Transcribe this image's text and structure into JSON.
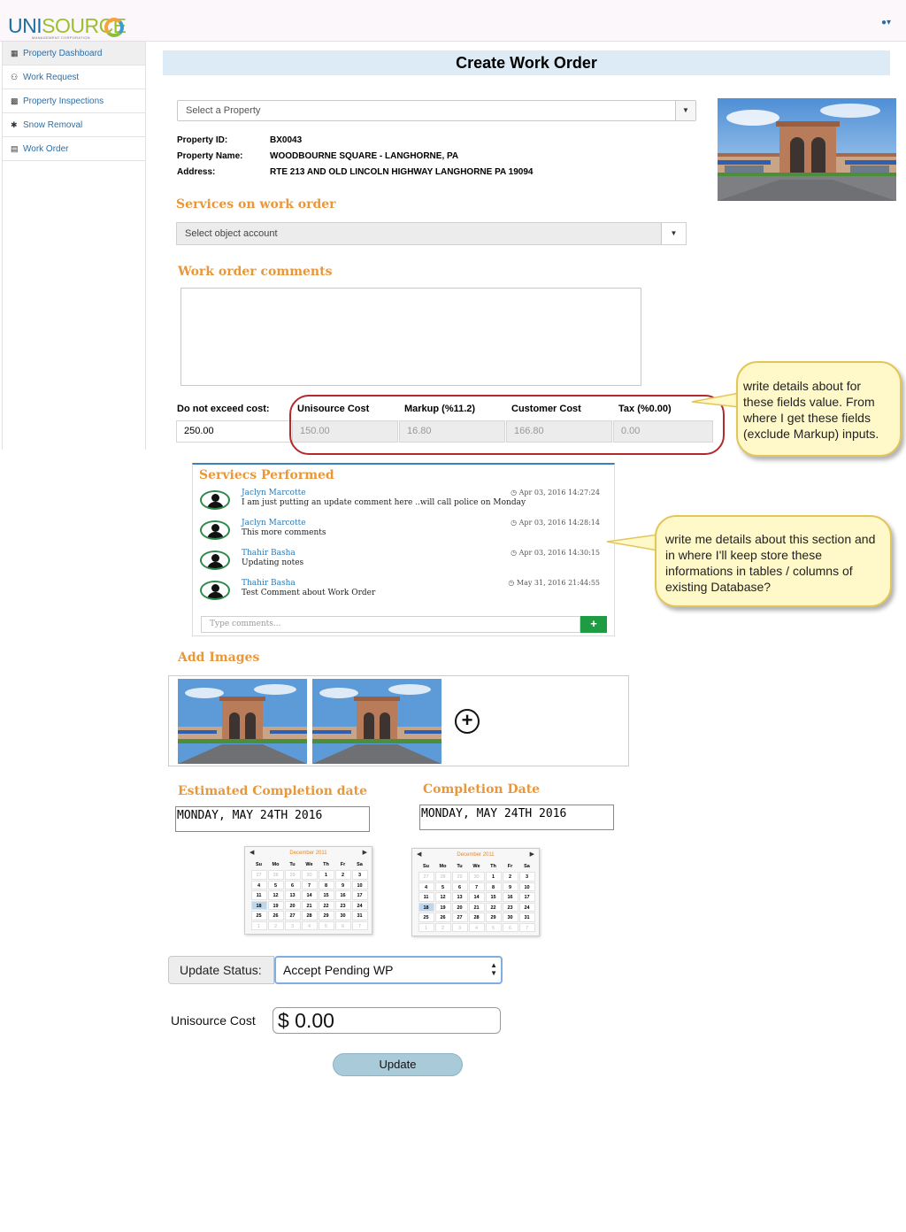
{
  "app": {
    "logo_main": "UNI",
    "logo_accent": "SOURCE",
    "logo_sub": "MANAGEMENT CORPORATION",
    "user_menu": "▾"
  },
  "sidebar": {
    "items": [
      {
        "label": "Property Dashboard",
        "icon": "building-icon"
      },
      {
        "label": "Work Request",
        "icon": "users-icon"
      },
      {
        "label": "Property Inspections",
        "icon": "folder-icon"
      },
      {
        "label": "Snow Removal",
        "icon": "shovel-icon"
      },
      {
        "label": "Work Order",
        "icon": "document-icon"
      }
    ]
  },
  "page": {
    "title": "Create Work Order"
  },
  "property": {
    "select_placeholder": "Select a Property",
    "id_label": "Property ID:",
    "id_value": "BX0043",
    "name_label": "Property Name:",
    "name_value": "WOODBOURNE SQUARE - LANGHORNE, PA",
    "address_label": "Address:",
    "address_value": "RTE 213 AND OLD LINCOLN HIGHWAY LANGHORNE PA 19094"
  },
  "services": {
    "heading": "Services on work order",
    "select_placeholder": "Select object account"
  },
  "comments": {
    "heading": "Work order comments"
  },
  "costs": {
    "dne_label": "Do not exceed cost:",
    "dne_value": "250.00",
    "unisource_label": "Unisource Cost",
    "unisource_value": "150.00",
    "markup_label": "Markup (%11.2)",
    "markup_value": "16.80",
    "customer_label": "Customer Cost",
    "customer_value": "166.80",
    "tax_label": "Tax (%0.00)",
    "tax_value": "0.00"
  },
  "callouts": {
    "c1": "write details about for these fields value. From where I get these fields (exclude Markup) inputs.",
    "c2": "write me details about this section and in where I'll keep store these informations in tables / columns of existing Database?"
  },
  "performed": {
    "heading": "Serviecs Performed",
    "entries": [
      {
        "name": "Jaclyn Marcotte",
        "text": "I am just putting an update comment here ..will call police on Monday",
        "time": "Apr 03, 2016 14:27:24"
      },
      {
        "name": "Jaclyn Marcotte",
        "text": "This more comments",
        "time": "Apr 03, 2016 14:28:14"
      },
      {
        "name": "Thahir Basha",
        "text": "Updating notes",
        "time": "Apr 03, 2016 14:30:15"
      },
      {
        "name": "Thahir Basha",
        "text": "Test Comment about Work Order",
        "time": "May 31, 2016 21:44:55"
      }
    ],
    "input_placeholder": "Type comments...",
    "add_label": "+"
  },
  "images": {
    "heading": "Add Images",
    "add_label": "+"
  },
  "dates": {
    "estimated_heading": "Estimated Completion date",
    "estimated_value": "MONDAY, MAY 24TH 2016",
    "completion_heading": "Completion Date",
    "completion_value": "MONDAY, MAY 24TH 2016",
    "calendar_month": "December 2011",
    "calendar_days_of_week": [
      "Su",
      "Mo",
      "Tu",
      "We",
      "Th",
      "Fr",
      "Sa"
    ],
    "calendar_cells": [
      "27",
      "28",
      "29",
      "30",
      "1",
      "2",
      "3",
      "4",
      "5",
      "6",
      "7",
      "8",
      "9",
      "10",
      "11",
      "12",
      "13",
      "14",
      "15",
      "16",
      "17",
      "18",
      "19",
      "20",
      "21",
      "22",
      "23",
      "24",
      "25",
      "26",
      "27",
      "28",
      "29",
      "30",
      "31",
      "1",
      "2",
      "3",
      "4",
      "5",
      "6",
      "7"
    ],
    "selected_day": "18"
  },
  "status": {
    "label": "Update Status:",
    "value": "Accept Pending WP"
  },
  "unisource_cost": {
    "label": "Unisource Cost",
    "value": "$ 0.00"
  },
  "actions": {
    "update_label": "Update"
  },
  "colors": {
    "accent_orange": "#e8973a",
    "link_blue": "#2a6fa8",
    "header_band": "#dcebf5",
    "callout_fill": "#fff8c8",
    "oval_red": "#b22a2a",
    "add_green": "#1f9b44"
  }
}
